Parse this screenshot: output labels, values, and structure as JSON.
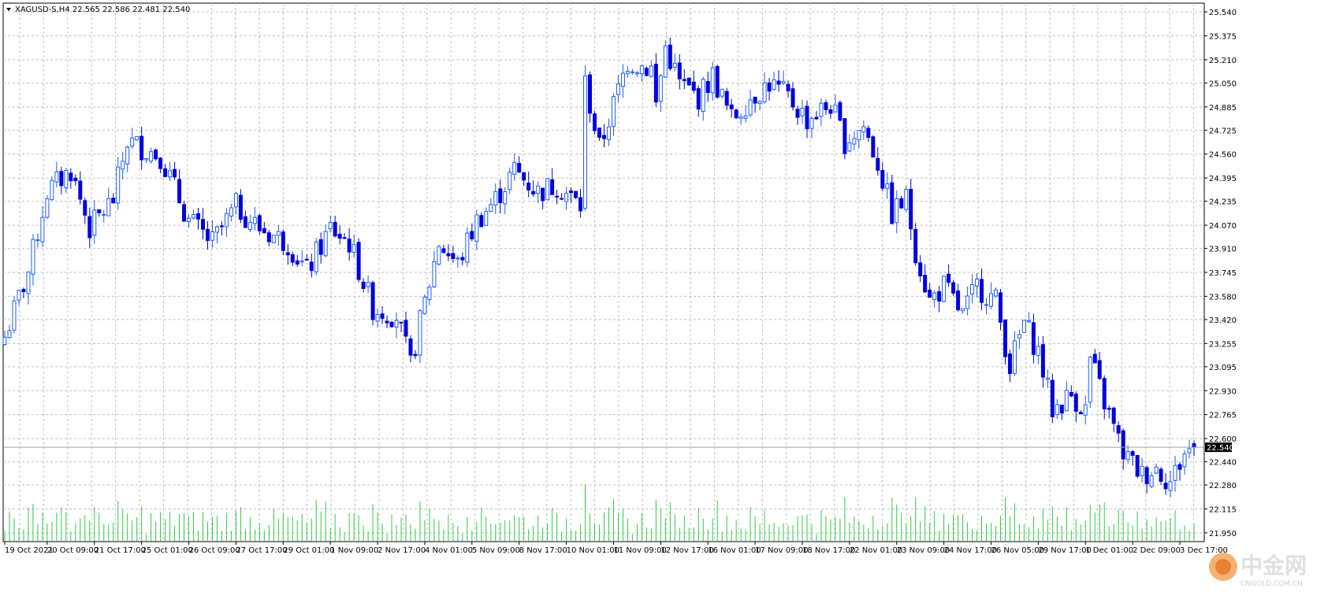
{
  "header": {
    "symbol_line": "XAGUSD-S,H4  22.565 22.586 22.481 22.540"
  },
  "colors": {
    "background": "#ffffff",
    "grid": "#c0c0c0",
    "bull_candle": "#1c5cff",
    "bear_candle": "#0000dd",
    "volume": "#2ecc40",
    "price_line": "#a0a0a0",
    "price_tag_bg": "#000000",
    "price_tag_text": "#ffffff"
  },
  "watermark": {
    "brand": "中金网",
    "url": "CNGOLD.COM.CN"
  },
  "chart_data": {
    "type": "candlestick",
    "symbol": "XAGUSD-S",
    "timeframe": "H4",
    "last_quote": {
      "open": 22.565,
      "high": 22.586,
      "low": 22.481,
      "close": 22.54
    },
    "current_price_label": "22.540",
    "y_range": [
      21.89,
      25.6
    ],
    "y_ticks": [
      "25.540",
      "25.375",
      "25.210",
      "25.050",
      "24.885",
      "24.725",
      "24.560",
      "24.395",
      "24.235",
      "24.070",
      "23.910",
      "23.745",
      "23.580",
      "23.420",
      "23.255",
      "23.095",
      "22.930",
      "22.765",
      "22.600",
      "22.440",
      "22.280",
      "22.115",
      "21.950"
    ],
    "x_labels": [
      {
        "index": 0,
        "label": "19 Oct 2021"
      },
      {
        "index": 9,
        "label": "20 Oct 09:00"
      },
      {
        "index": 19,
        "label": "21 Oct 17:00"
      },
      {
        "index": 29,
        "label": "25 Oct 01:00"
      },
      {
        "index": 39,
        "label": "26 Oct 09:00"
      },
      {
        "index": 49,
        "label": "27 Oct 17:00"
      },
      {
        "index": 59,
        "label": "29 Oct 01:00"
      },
      {
        "index": 69,
        "label": "1 Nov 09:00"
      },
      {
        "index": 79,
        "label": "2 Nov 17:00"
      },
      {
        "index": 89,
        "label": "4 Nov 01:00"
      },
      {
        "index": 99,
        "label": "5 Nov 09:00"
      },
      {
        "index": 109,
        "label": "8 Nov 17:00"
      },
      {
        "index": 119,
        "label": "10 Nov 01:00"
      },
      {
        "index": 129,
        "label": "11 Nov 09:00"
      },
      {
        "index": 139,
        "label": "12 Nov 17:00"
      },
      {
        "index": 149,
        "label": "16 Nov 01:00"
      },
      {
        "index": 159,
        "label": "17 Nov 09:00"
      },
      {
        "index": 169,
        "label": "18 Nov 17:00"
      },
      {
        "index": 179,
        "label": "22 Nov 01:00"
      },
      {
        "index": 189,
        "label": "23 Nov 09:00"
      },
      {
        "index": 199,
        "label": "24 Nov 17:00"
      },
      {
        "index": 209,
        "label": "26 Nov 05:00"
      },
      {
        "index": 219,
        "label": "29 Nov 17:00"
      },
      {
        "index": 229,
        "label": "1 Dec 01:00"
      },
      {
        "index": 239,
        "label": "2 Dec 09:00"
      },
      {
        "index": 249,
        "label": "3 Dec 17:00"
      }
    ],
    "volume_max": 100,
    "close_anchors": [
      [
        0,
        23.3
      ],
      [
        5,
        23.75
      ],
      [
        9,
        24.3
      ],
      [
        14,
        24.45
      ],
      [
        18,
        24.05
      ],
      [
        23,
        24.25
      ],
      [
        26,
        24.65
      ],
      [
        33,
        24.55
      ],
      [
        39,
        24.1
      ],
      [
        44,
        23.95
      ],
      [
        49,
        24.2
      ],
      [
        54,
        24.05
      ],
      [
        60,
        23.95
      ],
      [
        64,
        23.75
      ],
      [
        69,
        24.05
      ],
      [
        73,
        23.95
      ],
      [
        78,
        23.5
      ],
      [
        83,
        23.45
      ],
      [
        86,
        23.1
      ],
      [
        88,
        23.4
      ],
      [
        92,
        23.95
      ],
      [
        96,
        23.8
      ],
      [
        100,
        24.1
      ],
      [
        104,
        24.25
      ],
      [
        108,
        24.45
      ],
      [
        113,
        24.3
      ],
      [
        117,
        24.35
      ],
      [
        122,
        24.2
      ],
      [
        123,
        25.05
      ],
      [
        126,
        24.6
      ],
      [
        129,
        24.9
      ],
      [
        132,
        25.2
      ],
      [
        137,
        25.15
      ],
      [
        138,
        24.9
      ],
      [
        140,
        25.3
      ],
      [
        143,
        25.05
      ],
      [
        147,
        24.95
      ],
      [
        150,
        25.1
      ],
      [
        154,
        24.8
      ],
      [
        158,
        24.95
      ],
      [
        162,
        25.05
      ],
      [
        166,
        24.95
      ],
      [
        170,
        24.8
      ],
      [
        175,
        24.9
      ],
      [
        178,
        24.65
      ],
      [
        182,
        24.75
      ],
      [
        185,
        24.5
      ],
      [
        188,
        24.15
      ],
      [
        191,
        24.25
      ],
      [
        193,
        23.9
      ],
      [
        196,
        23.55
      ],
      [
        199,
        23.65
      ],
      [
        203,
        23.45
      ],
      [
        206,
        23.65
      ],
      [
        210,
        23.55
      ],
      [
        213,
        23.1
      ],
      [
        216,
        23.4
      ],
      [
        219,
        23.2
      ],
      [
        222,
        22.8
      ],
      [
        226,
        22.9
      ],
      [
        229,
        22.8
      ],
      [
        230,
        23.15
      ],
      [
        233,
        22.85
      ],
      [
        237,
        22.5
      ],
      [
        241,
        22.35
      ],
      [
        244,
        22.4
      ],
      [
        247,
        22.3
      ],
      [
        250,
        22.5
      ],
      [
        252,
        22.54
      ]
    ]
  }
}
